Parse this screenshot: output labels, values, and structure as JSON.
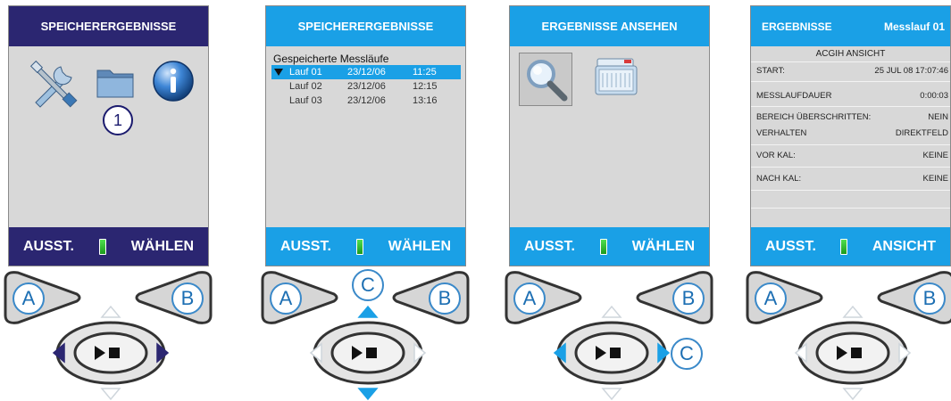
{
  "panels": [
    {
      "header": "SPEICHERERGEBNISSE",
      "footer_left": "AUSST.",
      "footer_right": "WÄHLEN",
      "badge": "1",
      "icons": [
        "tools-icon",
        "folder-icon",
        "info-icon"
      ],
      "controls": {
        "a": "A",
        "b": "B"
      }
    },
    {
      "header": "SPEICHERERGEBNISSE",
      "list_title": "Gespeicherte Messläufe",
      "rows": [
        {
          "name": "Lauf 01",
          "date": "23/12/06",
          "time": "11:25"
        },
        {
          "name": "Lauf 02",
          "date": "23/12/06",
          "time": "12:15"
        },
        {
          "name": "Lauf 03",
          "date": "23/12/06",
          "time": "13:16"
        }
      ],
      "footer_left": "AUSST.",
      "footer_right": "WÄHLEN",
      "controls": {
        "a": "A",
        "b": "B",
        "c": "C"
      }
    },
    {
      "header": "ERGEBNISSE ANSEHEN",
      "icons": [
        "magnifier-icon",
        "printer-icon"
      ],
      "footer_left": "AUSST.",
      "footer_right": "WÄHLEN",
      "controls": {
        "a": "A",
        "b": "B",
        "c": "C"
      }
    },
    {
      "header_left": "ERGEBNISSE",
      "header_right": "Messlauf 01",
      "subtitle": "ACGIH ANSICHT",
      "rows": [
        {
          "label": "START:",
          "value": "25 JUL 08  17:07:46"
        },
        {
          "label": "MESSLAUFDAUER",
          "value": "0:00:03"
        },
        {
          "label": "BEREICH ÜBERSCHRITTEN:",
          "value": "NEIN"
        },
        {
          "label": "VERHALTEN",
          "value": "DIREKTFELD"
        },
        {
          "label": "VOR KAL:",
          "value": "KEINE"
        },
        {
          "label": "NACH KAL:",
          "value": "KEINE"
        }
      ],
      "footer_left": "AUSST.",
      "footer_right": "ANSICHT",
      "controls": {
        "a": "A",
        "b": "B"
      }
    }
  ],
  "colors": {
    "dark_header": "#2b2671",
    "blue_header": "#1aa0e6",
    "screen_bg": "#d8d8d8",
    "arrow_dark": "#2b2671",
    "arrow_blue": "#1aa0e6",
    "arrow_inactive": "#cfd6dc"
  }
}
